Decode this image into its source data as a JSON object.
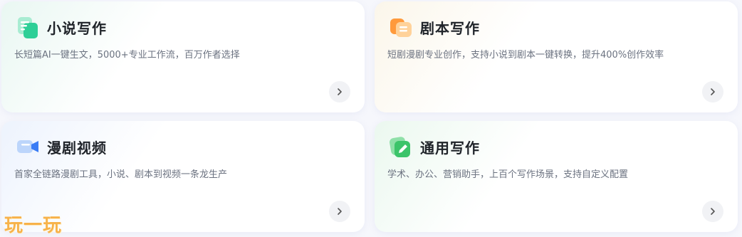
{
  "cards": [
    {
      "title": "小说写作",
      "desc": "长短篇AI一键生文，5000+专业工作流，百万作者选择",
      "icon": "document-icon",
      "accent": "#2ecf97"
    },
    {
      "title": "剧本写作",
      "desc": "短剧漫剧专业创作，支持小说到剧本一键转换，提升400%创作效率",
      "icon": "script-icon",
      "accent": "#ff8a2b"
    },
    {
      "title": "漫剧视频",
      "desc": "首家全链路漫剧工具，小说、剧本到视频一条龙生产",
      "icon": "video-camera-icon",
      "accent": "#3a7cf5"
    },
    {
      "title": "通用写作",
      "desc": "学术、办公、营销助手，上百个写作场景，支持自定义配置",
      "icon": "pen-icon",
      "accent": "#3cc46a"
    }
  ],
  "watermark": "玩一玩"
}
